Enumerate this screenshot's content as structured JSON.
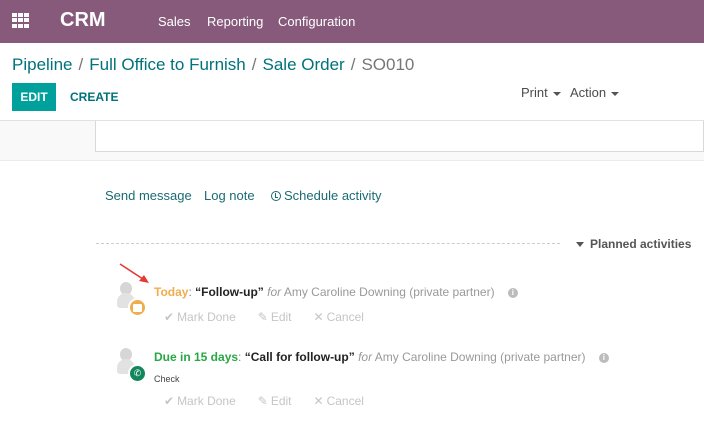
{
  "topbar": {
    "brand": "CRM",
    "menu": [
      "Sales",
      "Reporting",
      "Configuration"
    ]
  },
  "breadcrumb": {
    "items": [
      "Pipeline",
      "Full Office to Furnish",
      "Sale Order"
    ],
    "separator": "/",
    "active": "SO010"
  },
  "toolbar": {
    "edit_label": "EDIT",
    "create_label": "CREATE",
    "print_label": "Print",
    "action_label": "Action"
  },
  "chatter": {
    "send_message": "Send message",
    "log_note": "Log note",
    "schedule_activity": "Schedule activity"
  },
  "planned": {
    "title": "Planned activities",
    "activities": [
      {
        "due": "Today",
        "name": "“Follow-up”",
        "for_text": "for",
        "partner": "Amy Caroline Downing (private partner)",
        "note": "",
        "badge_icon": "shirt-icon",
        "badge_color": "#f0ad4e"
      },
      {
        "due": "Due in 15 days",
        "name": "“Call for follow-up”",
        "for_text": "for",
        "partner": "Amy Caroline Downing (private partner)",
        "note": "Check",
        "badge_icon": "phone-icon",
        "badge_color": "#13865e"
      }
    ],
    "mark_done": "Mark Done",
    "edit": "Edit",
    "cancel": "Cancel",
    "colon": ":"
  },
  "colors": {
    "topbar": "#875a7b",
    "primary_button": "#00a09d",
    "link": "#00727b",
    "due_today": "#f0ad4e",
    "due_future": "#28a745",
    "annotation_arrow": "#e53935"
  }
}
